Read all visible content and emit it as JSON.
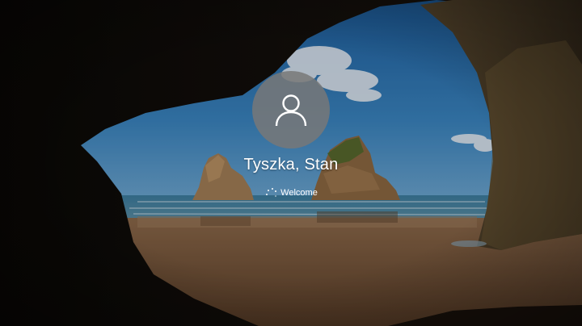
{
  "lock_screen": {
    "user": {
      "name": "Tyszka, Stan",
      "avatar_icon": "person-icon"
    },
    "status": {
      "text": "Welcome",
      "spinner_icon": "loading-spinner-icon"
    }
  }
}
